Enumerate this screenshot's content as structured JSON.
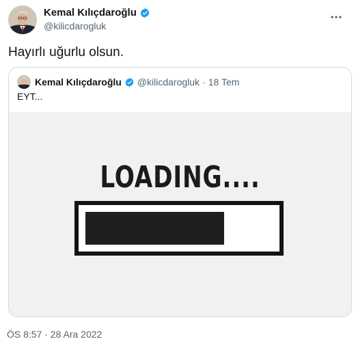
{
  "tweet": {
    "author_name": "Kemal Kılıçdaroğlu",
    "author_handle": "@kilicdarogluk",
    "text": "Hayırlı uğurlu olsun.",
    "timestamp": "ÖS 8:57 · 28 Ara 2022"
  },
  "quoted_tweet": {
    "author_name": "Kemal Kılıçdaroğlu",
    "author_handle": "@kilicdarogluk",
    "separator": "·",
    "date": "18 Tem",
    "text": "EYT...",
    "image": {
      "loading_text": "LOADING....",
      "progress": 0.74
    }
  },
  "colors": {
    "verified_badge": "#1d9bf0",
    "secondary_text": "#536471",
    "border": "#cfd9de"
  },
  "icons": {
    "verified": "verified-badge-icon",
    "more": "more-icon"
  }
}
